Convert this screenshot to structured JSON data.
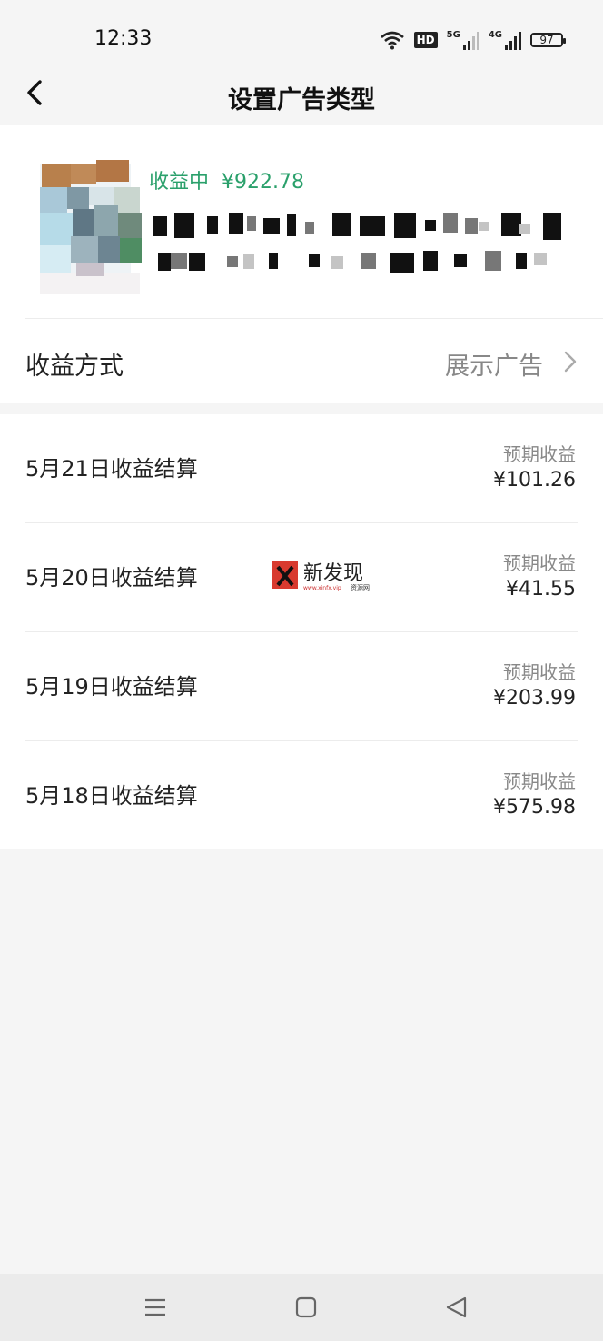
{
  "status_bar": {
    "time": "12:33",
    "hd_label": "HD",
    "net1_label": "5G",
    "net2_label": "4G",
    "battery": "97",
    "icons": [
      "wifi-icon",
      "hd-icon",
      "signal-5g-icon",
      "signal-4g-icon",
      "battery-icon"
    ]
  },
  "header": {
    "title": "设置广告类型",
    "back_icon": "chevron-left-icon"
  },
  "ad_card": {
    "status_label": "收益中",
    "amount": "¥922.78",
    "accent_color": "#2aa06b"
  },
  "earning_method": {
    "label": "收益方式",
    "value": "展示广告",
    "icon": "chevron-right-icon"
  },
  "settlements": [
    {
      "date_label": "5月21日收益结算",
      "expected_label": "预期收益",
      "expected_value": "¥101.26"
    },
    {
      "date_label": "5月20日收益结算",
      "expected_label": "预期收益",
      "expected_value": "¥41.55"
    },
    {
      "date_label": "5月19日收益结算",
      "expected_label": "预期收益",
      "expected_value": "¥203.99"
    },
    {
      "date_label": "5月18日收益结算",
      "expected_label": "预期收益",
      "expected_value": "¥575.98"
    }
  ],
  "watermark": {
    "main_text": "新发现",
    "sub_text": "www.xinfx.vip",
    "sub_text2": "资源网"
  },
  "nav_bar": {
    "icons": [
      "menu-icon",
      "home-square-icon",
      "back-triangle-icon"
    ]
  }
}
